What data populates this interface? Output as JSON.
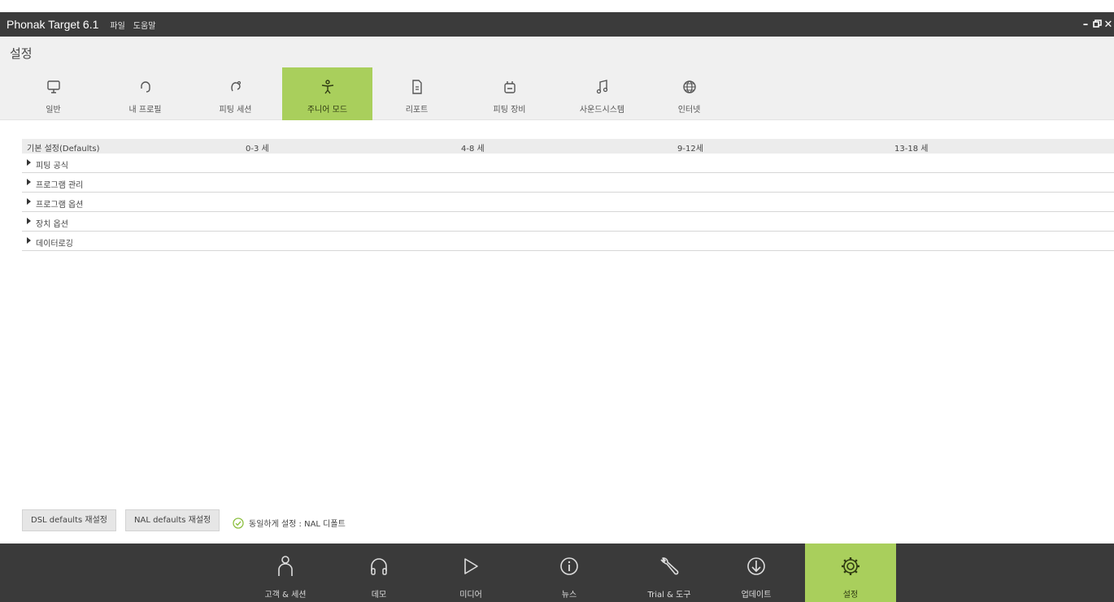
{
  "window": {
    "app_title": "Phonak Target 6.1",
    "menu": [
      "파일",
      "도움말"
    ],
    "controls": [
      "minimize-icon",
      "restore-icon",
      "close-icon"
    ]
  },
  "page": {
    "title": "설정"
  },
  "settings_tabs": [
    {
      "label": "일반",
      "icon": "monitor-icon",
      "active": false
    },
    {
      "label": "내 프로필",
      "icon": "headset-icon",
      "active": false
    },
    {
      "label": "피팅 세션",
      "icon": "ear-icon",
      "active": false
    },
    {
      "label": "주니어 모드",
      "icon": "children-icon",
      "active": true
    },
    {
      "label": "리포트",
      "icon": "document-icon",
      "active": false
    },
    {
      "label": "피팅 장비",
      "icon": "device-icon",
      "active": false
    },
    {
      "label": "사운드시스템",
      "icon": "music-note-icon",
      "active": false
    },
    {
      "label": "인터넷",
      "icon": "globe-icon",
      "active": false
    }
  ],
  "table": {
    "headers": [
      "기본 설정(Defaults)",
      "0-3 세",
      "4-8 세",
      "9-12세",
      "13-18 세"
    ],
    "rows": [
      "피팅 공식",
      "프로그램 관리",
      "프로그램 옵션",
      "장치 옵션",
      "데이터로깅"
    ]
  },
  "buttons": {
    "dsl_reset": "DSL defaults 재설정",
    "nal_reset": "NAL defaults 재설정"
  },
  "status_text": "동일하게 설정 : NAL 디폴트",
  "bottom_tabs": [
    {
      "label": "고객 & 세션",
      "icon": "person-icon",
      "active": false
    },
    {
      "label": "데모",
      "icon": "headphones-icon",
      "active": false
    },
    {
      "label": "미디어",
      "icon": "play-icon",
      "active": false
    },
    {
      "label": "뉴스",
      "icon": "info-icon",
      "active": false
    },
    {
      "label": "Trial & 도구",
      "icon": "wrench-icon",
      "active": false
    },
    {
      "label": "업데이트",
      "icon": "download-icon",
      "active": false
    },
    {
      "label": "설정",
      "icon": "gear-icon",
      "active": true
    }
  ],
  "colors": {
    "accent": "#a9cf5c",
    "titlebar": "#3b3b3b",
    "bottombar": "#3a3a3a"
  }
}
